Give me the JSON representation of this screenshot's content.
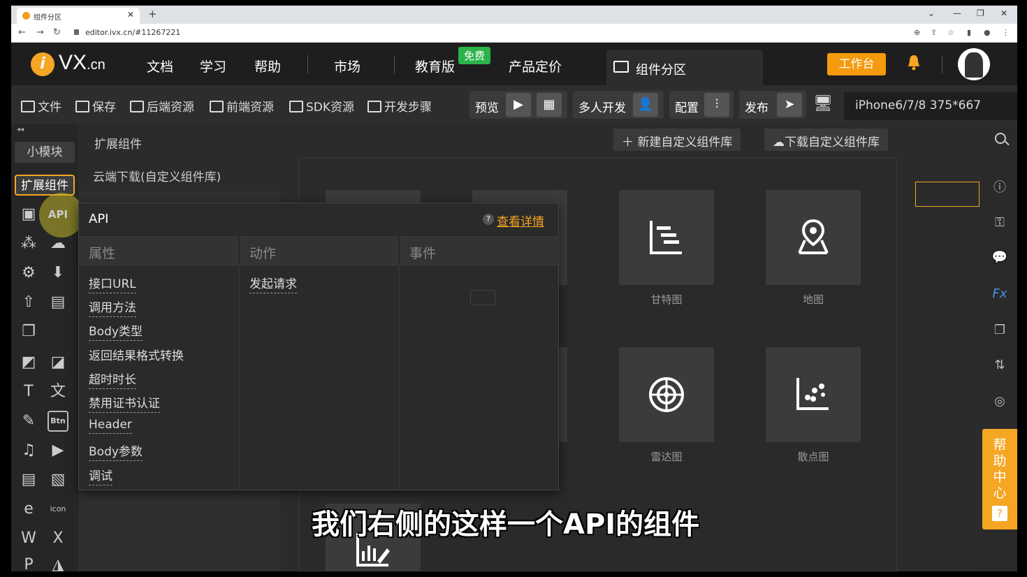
{
  "browser": {
    "tab_title": "组件分区",
    "url": "editor.ivx.cn/#11267221"
  },
  "topnav": {
    "logo_letter": "i",
    "logo_main": "VX",
    "logo_suffix": ".cn",
    "items": [
      "文档",
      "学习",
      "帮助",
      "市场",
      "教育版",
      "产品定价"
    ],
    "free_badge": "免费",
    "active_tab": "组件分区",
    "workbench": "工作台"
  },
  "toolbar": {
    "file": "文件",
    "save": "保存",
    "backend": "后端资源",
    "frontend": "前端资源",
    "sdk": "SDK资源",
    "steps": "开发步骤",
    "preview": "预览",
    "multi_dev": "多人开发",
    "config": "配置",
    "publish": "发布",
    "device": "iPhone6/7/8 375*667"
  },
  "leftbar": {
    "small_module": "小模块",
    "ext_component": "扩展组件",
    "api_label": "API",
    "btn_label": "Btn",
    "icon_label": "icon"
  },
  "panel": {
    "header": "扩展组件",
    "new_lib": "新建自定义组件库",
    "download_lib": "下载自定义组件库",
    "cloud_download": "云端下载(自定义组件库)"
  },
  "cards": [
    {
      "label": "甘特图",
      "icon": "gantt-icon"
    },
    {
      "label": "地图",
      "icon": "map-icon"
    },
    {
      "label": "雷达图",
      "icon": "radar-icon"
    },
    {
      "label": "散点图",
      "icon": "scatter-icon"
    }
  ],
  "popup": {
    "title": "API",
    "detail_link": "查看详情",
    "col_props": "属性",
    "col_actions": "动作",
    "col_events": "事件",
    "props": [
      "接口URL",
      "调用方法",
      "Body类型",
      "返回结果格式转换",
      "超时时长",
      "禁用证书认证",
      "Header",
      "Body参数",
      "调试"
    ],
    "actions": [
      "发起请求"
    ]
  },
  "help_center": "帮助中心",
  "subtitle": "我们右侧的这样一个API的组件",
  "colors": {
    "accent": "#f5a623",
    "free_badge": "#2bb34a",
    "background": "#2b2b2b"
  }
}
